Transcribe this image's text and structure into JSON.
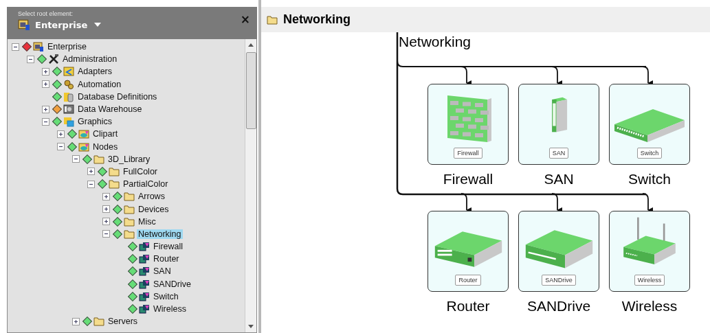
{
  "root_selector": {
    "caption": "Select root element:",
    "value": "Enterprise",
    "close": "×"
  },
  "tree": [
    {
      "label": "Enterprise",
      "kind": "root",
      "color": "#e8323c",
      "expanded": true,
      "selected": false,
      "children": [
        {
          "label": "Administration",
          "kind": "tools",
          "color": "#66dd77",
          "expanded": true,
          "selected": false,
          "children": [
            {
              "label": "Adapters",
              "kind": "adapters",
              "color": "#66dd77",
              "expanded": false,
              "selected": false
            },
            {
              "label": "Automation",
              "kind": "automation",
              "color": "#66dd77",
              "expanded": false,
              "selected": false
            },
            {
              "label": "Database Definitions",
              "kind": "database",
              "color": "#66dd77",
              "selected": false
            },
            {
              "label": "Data Warehouse",
              "kind": "warehouse",
              "color": "#f0a040",
              "expanded": false,
              "selected": false
            },
            {
              "label": "Graphics",
              "kind": "graphics",
              "color": "#66dd77",
              "expanded": true,
              "selected": false,
              "children": [
                {
                  "label": "Clipart",
                  "kind": "library",
                  "color": "#66dd77",
                  "expanded": false,
                  "selected": false
                },
                {
                  "label": "Nodes",
                  "kind": "library",
                  "color": "#66dd77",
                  "expanded": true,
                  "selected": false,
                  "children": [
                    {
                      "label": "3D_Library",
                      "kind": "folder",
                      "color": "#66dd77",
                      "expanded": true,
                      "selected": false,
                      "children": [
                        {
                          "label": "FullColor",
                          "kind": "folder",
                          "color": "#66dd77",
                          "expanded": false,
                          "selected": false
                        },
                        {
                          "label": "PartialColor",
                          "kind": "folder",
                          "color": "#66dd77",
                          "expanded": true,
                          "selected": false,
                          "children": [
                            {
                              "label": "Arrows",
                              "kind": "folder",
                              "color": "#66dd77",
                              "expanded": false,
                              "selected": false
                            },
                            {
                              "label": "Devices",
                              "kind": "folder",
                              "color": "#66dd77",
                              "expanded": false,
                              "selected": false
                            },
                            {
                              "label": "Misc",
                              "kind": "folder",
                              "color": "#66dd77",
                              "expanded": false,
                              "selected": false
                            },
                            {
                              "label": "Networking",
                              "kind": "folder",
                              "color": "#66dd77",
                              "expanded": true,
                              "selected": true,
                              "children": [
                                {
                                  "label": "Firewall",
                                  "kind": "node",
                                  "color": "#66dd77",
                                  "selected": false
                                },
                                {
                                  "label": "Router",
                                  "kind": "node",
                                  "color": "#66dd77",
                                  "selected": false
                                },
                                {
                                  "label": "SAN",
                                  "kind": "node",
                                  "color": "#66dd77",
                                  "selected": false
                                },
                                {
                                  "label": "SANDrive",
                                  "kind": "node",
                                  "color": "#66dd77",
                                  "selected": false
                                },
                                {
                                  "label": "Switch",
                                  "kind": "node",
                                  "color": "#66dd77",
                                  "selected": false
                                },
                                {
                                  "label": "Wireless",
                                  "kind": "node",
                                  "color": "#66dd77",
                                  "selected": false
                                }
                              ]
                            }
                          ]
                        }
                      ]
                    },
                    {
                      "label": "Servers",
                      "kind": "folder",
                      "color": "#66dd77",
                      "expanded": false,
                      "selected": false
                    }
                  ]
                }
              ]
            }
          ]
        }
      ]
    }
  ],
  "view": {
    "title": "Networking",
    "diagram_title": "Networking",
    "nodes": [
      {
        "kind": "firewall",
        "badge": "Firewall",
        "caption": "Firewall"
      },
      {
        "kind": "san",
        "badge": "SAN",
        "caption": "SAN"
      },
      {
        "kind": "switch",
        "badge": "Switch",
        "caption": "Switch"
      },
      {
        "kind": "router",
        "badge": "Router",
        "caption": "Router"
      },
      {
        "kind": "sandrive",
        "badge": "SANDrive",
        "caption": "SANDrive"
      },
      {
        "kind": "wireless",
        "badge": "Wireless",
        "caption": "Wireless"
      }
    ]
  }
}
